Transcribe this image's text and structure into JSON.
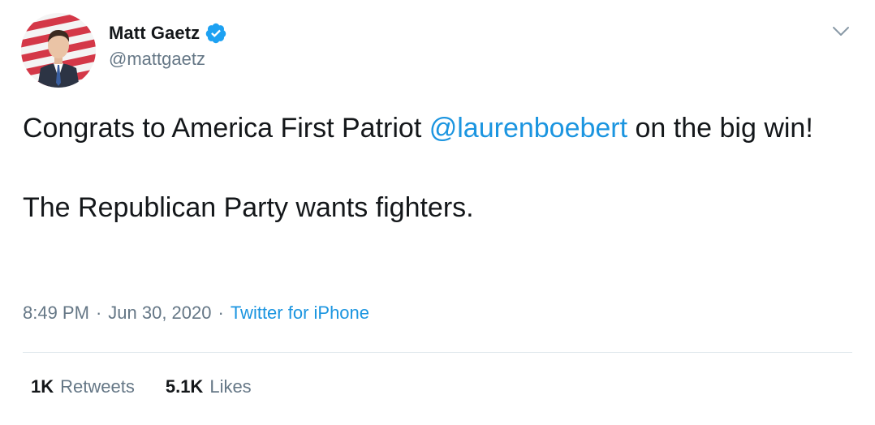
{
  "author": {
    "display_name": "Matt Gaetz",
    "handle": "@mattgaetz",
    "verified": true,
    "avatar_icon": "profile-photo"
  },
  "tweet": {
    "text_before": "Congrats to America First Patriot ",
    "mention": "@laurenboebert",
    "text_after": " on the big win!\n\nThe Republican Party wants fighters."
  },
  "meta": {
    "time": "8:49 PM",
    "separator": "·",
    "date": "Jun 30, 2020",
    "source": "Twitter for iPhone"
  },
  "stats": {
    "retweets_count": "1K",
    "retweets_label": "Retweets",
    "likes_count": "5.1K",
    "likes_label": "Likes"
  },
  "colors": {
    "link": "#1b95e0",
    "secondary_text": "#657786",
    "primary_text": "#14171a",
    "divider": "#e1e8ed",
    "verified_badge": "#1da1f2"
  }
}
